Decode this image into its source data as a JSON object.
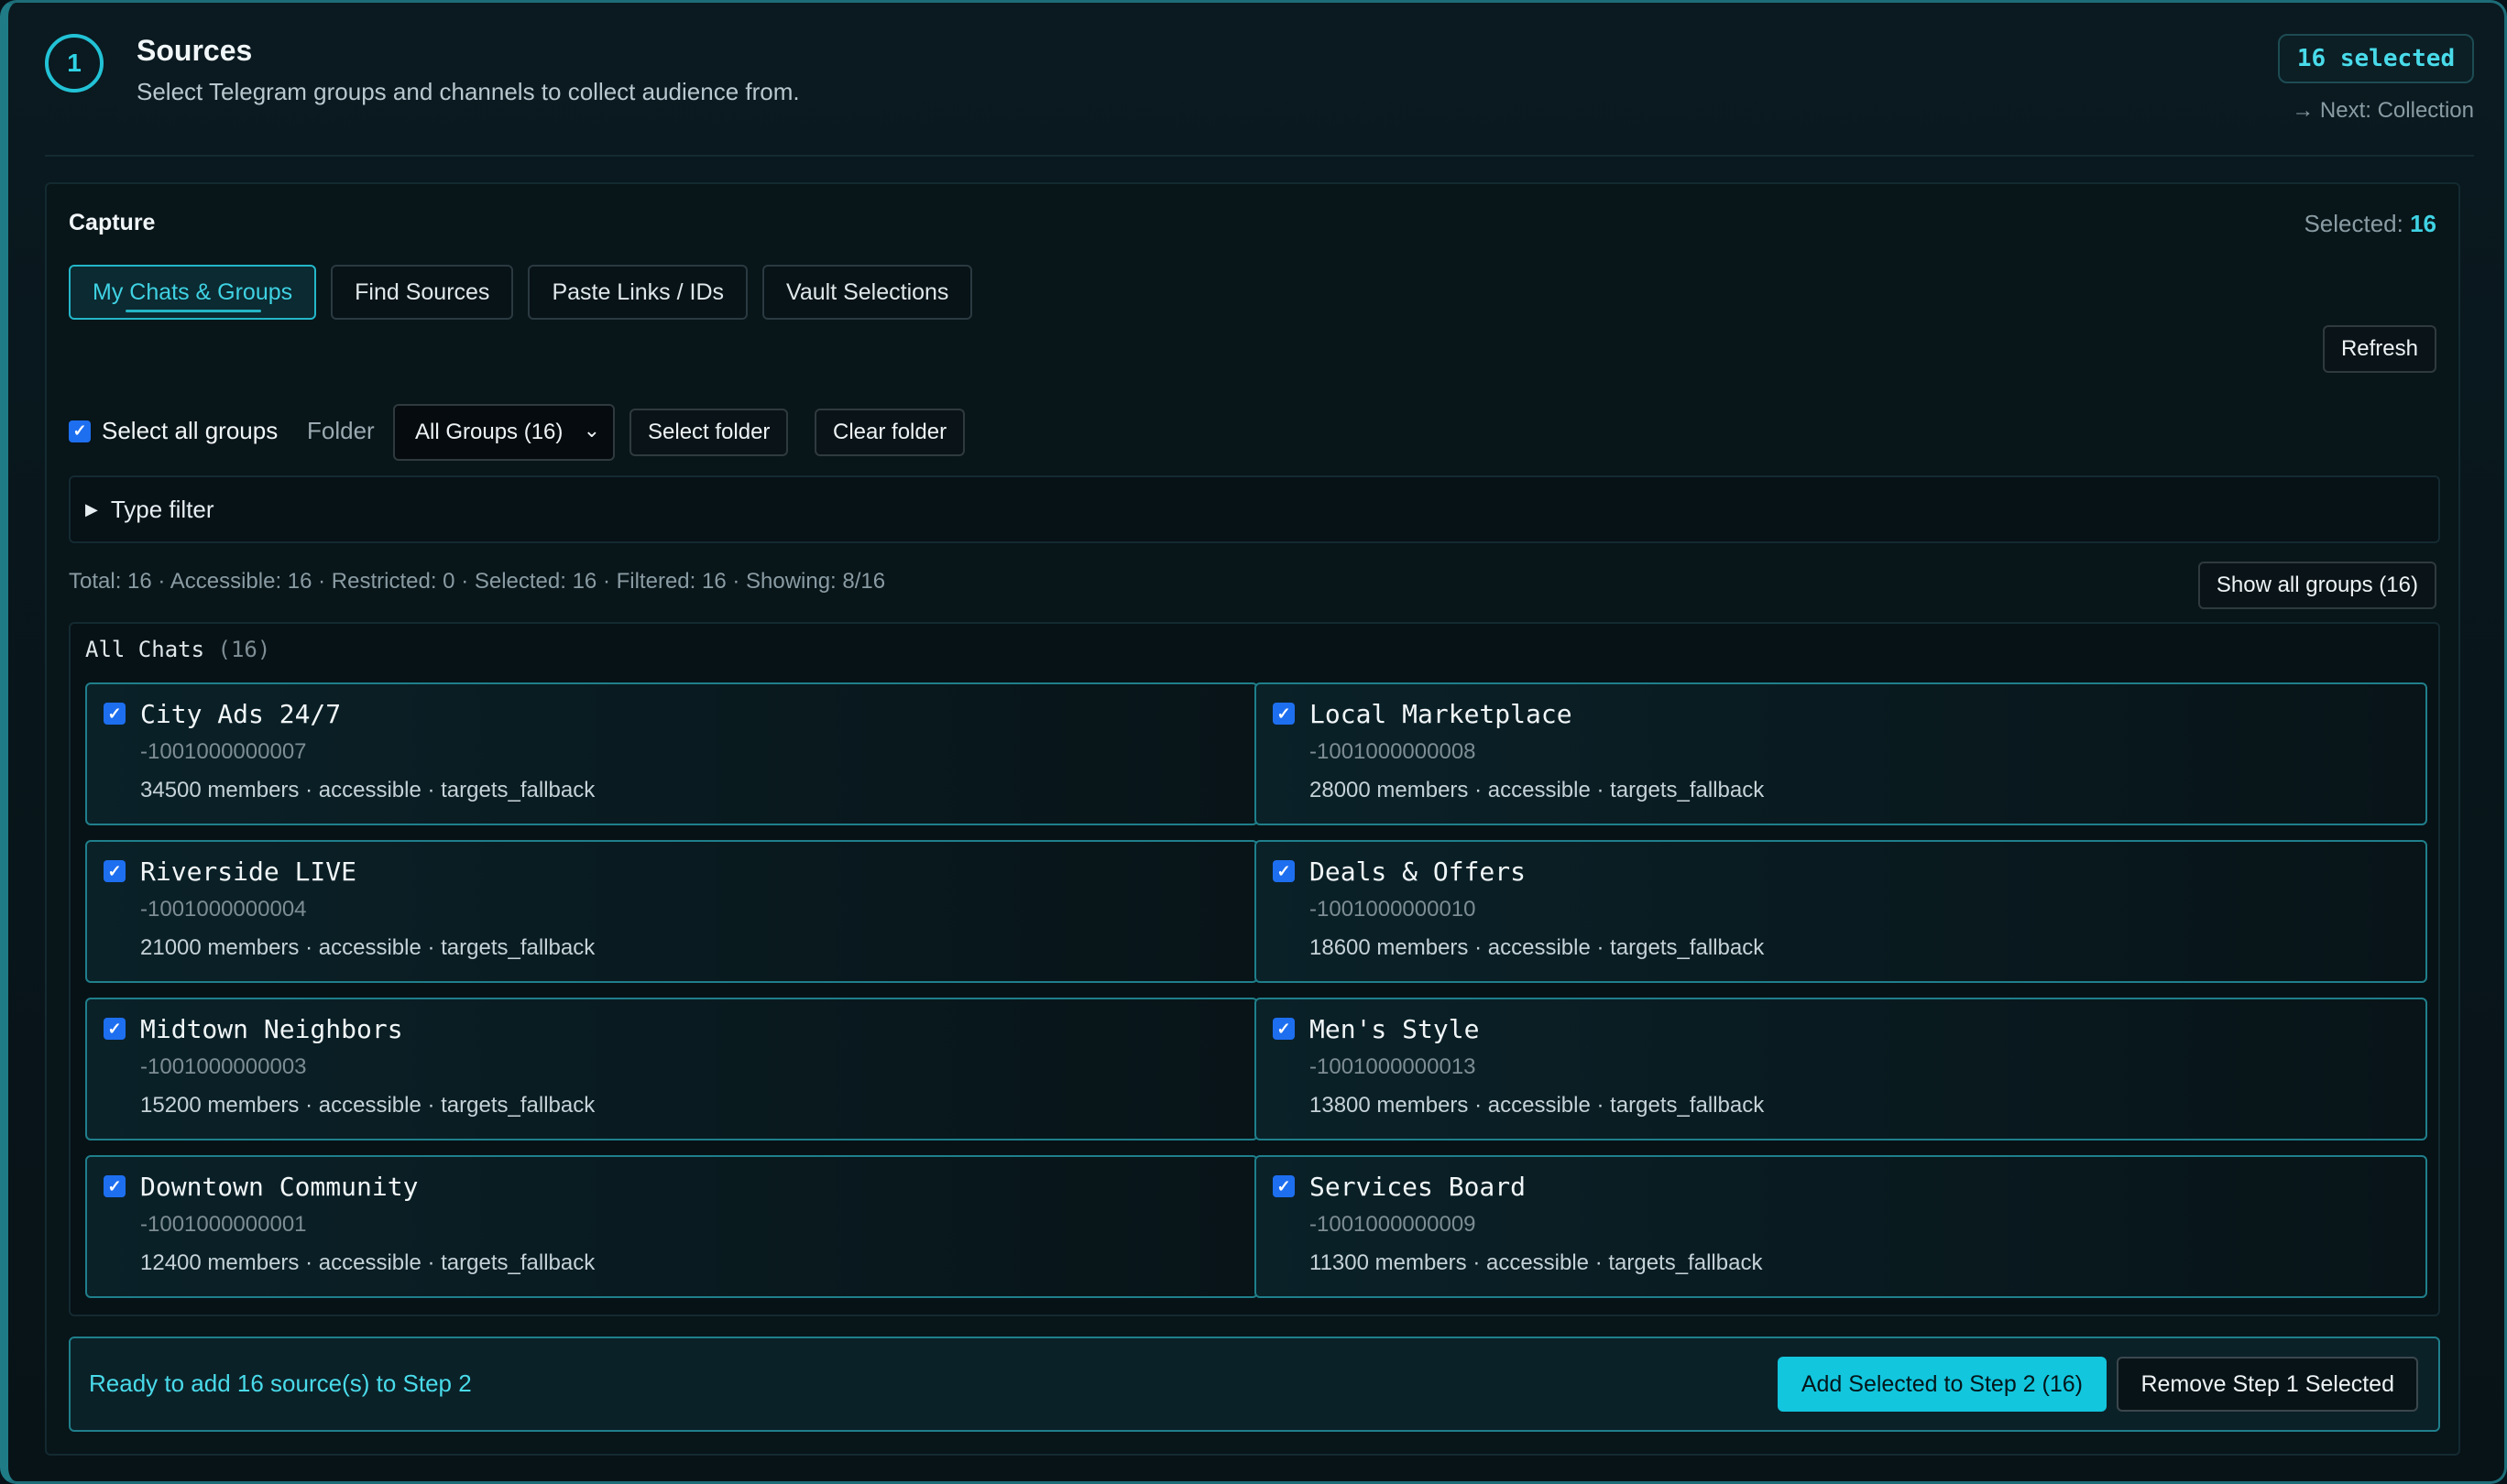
{
  "header": {
    "step_number": "1",
    "title": "Sources",
    "subtitle": "Select Telegram groups and channels to collect audience from.",
    "selected_badge": "16 selected",
    "next_link": "→ Next: Collection"
  },
  "capture": {
    "title": "Capture",
    "selected_label": "Selected: ",
    "selected_count": "16",
    "tabs": [
      {
        "label": "My Chats & Groups",
        "active": true
      },
      {
        "label": "Find Sources",
        "active": false
      },
      {
        "label": "Paste Links / IDs",
        "active": false
      },
      {
        "label": "Vault Selections",
        "active": false
      }
    ],
    "refresh_label": "Refresh",
    "select_all_label": "Select all groups",
    "folder_label": "Folder",
    "folder_value": "All Groups (16)",
    "select_folder_label": "Select folder",
    "clear_folder_label": "Clear folder",
    "type_filter_label": "Type filter",
    "stats": "Total: 16 · Accessible: 16 · Restricted: 0 · Selected: 16 · Filtered: 16 · Showing: 8/16",
    "show_all_label": "Show all groups (16)"
  },
  "chats": {
    "title": "All Chats",
    "count": "(16)",
    "items": [
      {
        "name": "City Ads 24/7",
        "id": "-1001000000007",
        "meta": "34500 members · accessible · targets_fallback"
      },
      {
        "name": "Local Marketplace",
        "id": "-1001000000008",
        "meta": "28000 members · accessible · targets_fallback"
      },
      {
        "name": "Riverside LIVE",
        "id": "-1001000000004",
        "meta": "21000 members · accessible · targets_fallback"
      },
      {
        "name": "Deals & Offers",
        "id": "-1001000000010",
        "meta": "18600 members · accessible · targets_fallback"
      },
      {
        "name": "Midtown Neighbors",
        "id": "-1001000000003",
        "meta": "15200 members · accessible · targets_fallback"
      },
      {
        "name": "Men's Style",
        "id": "-1001000000013",
        "meta": "13800 members · accessible · targets_fallback"
      },
      {
        "name": "Downtown Community",
        "id": "-1001000000001",
        "meta": "12400 members · accessible · targets_fallback"
      },
      {
        "name": "Services Board",
        "id": "-1001000000009",
        "meta": "11300 members · accessible · targets_fallback"
      }
    ]
  },
  "footer": {
    "ready_text": "Ready to add 16 source(s) to Step 2",
    "add_label": "Add Selected to Step 2 (16)",
    "remove_label": "Remove Step 1 Selected"
  },
  "colors": {
    "accent": "#22c2d6",
    "checkbox": "#1e6ff0",
    "background": "#071218"
  }
}
